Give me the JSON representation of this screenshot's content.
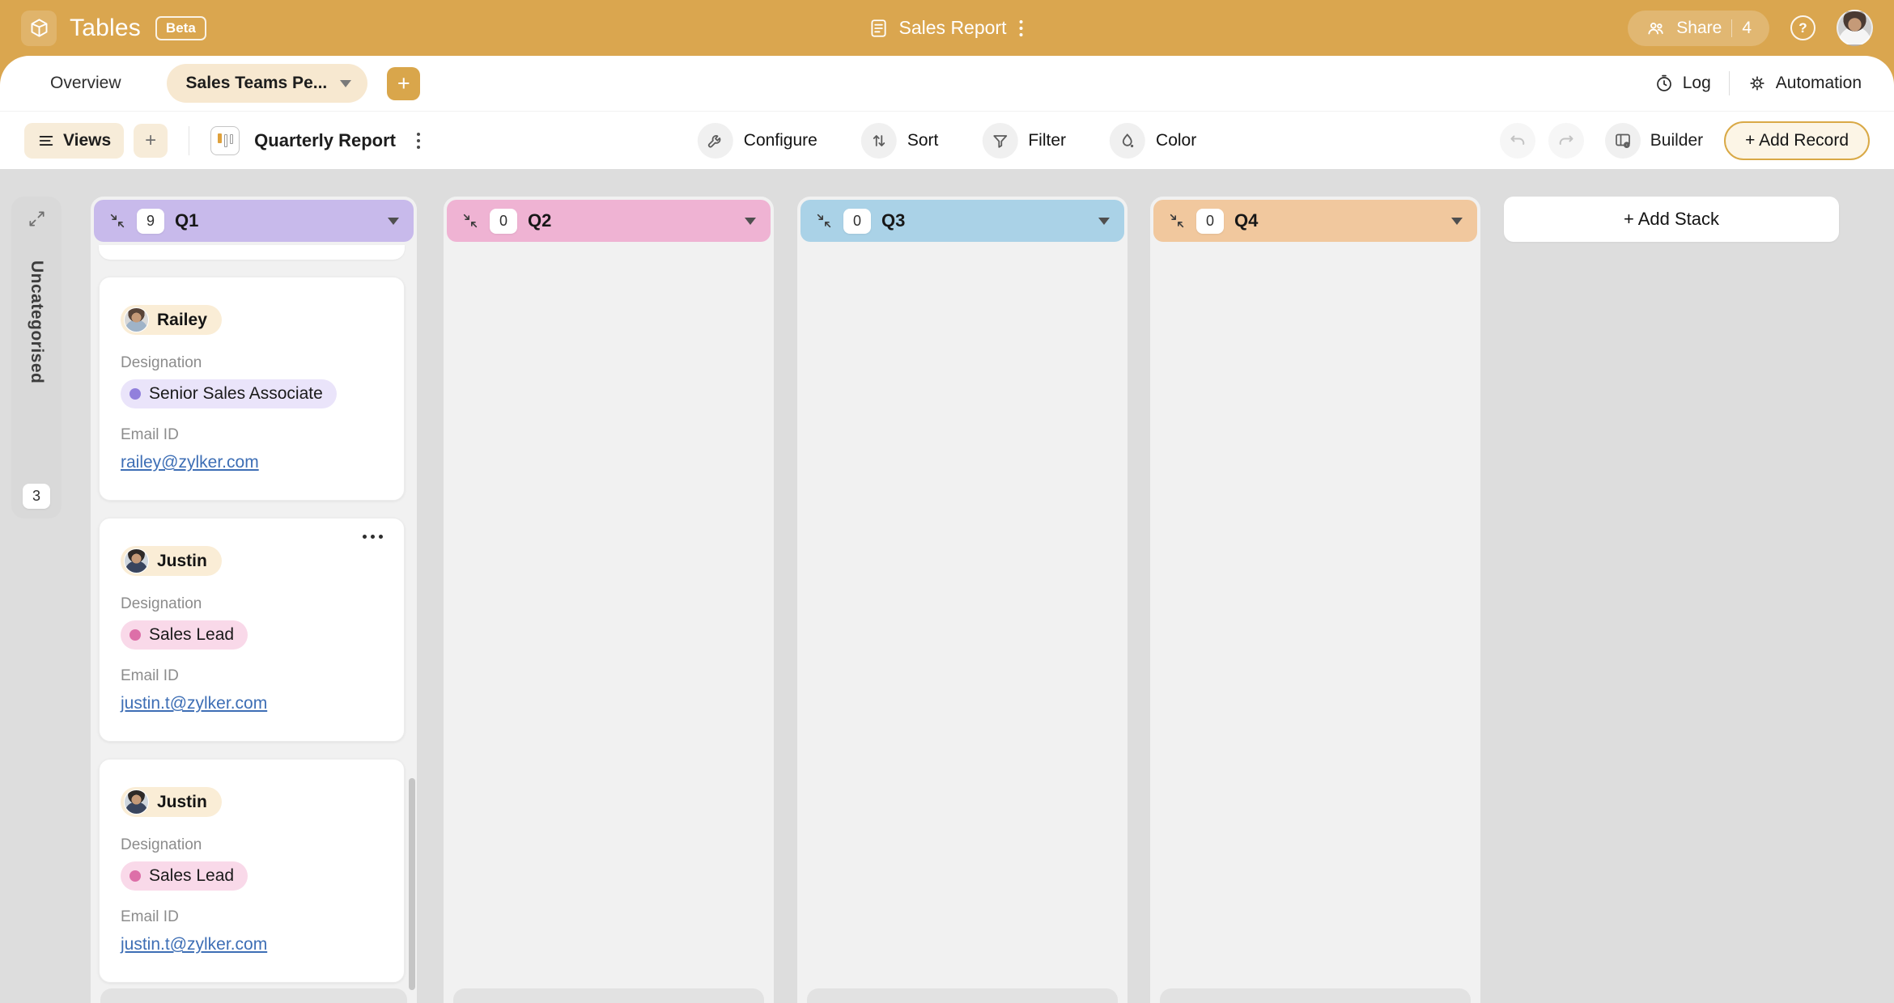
{
  "app": {
    "name": "Tables",
    "beta": "Beta",
    "doc_title": "Sales Report",
    "share_label": "Share",
    "share_count": "4",
    "help_glyph": "?",
    "header_color": "#DAA64F"
  },
  "tabbar": {
    "overview": "Overview",
    "view_selector": "Sales Teams Pe...",
    "add": "+",
    "log": "Log",
    "automation": "Automation"
  },
  "toolbar": {
    "views": "Views",
    "add": "+",
    "view_name": "Quarterly Report",
    "configure": "Configure",
    "sort": "Sort",
    "filter": "Filter",
    "color": "Color",
    "builder": "Builder",
    "add_record": "+ Add Record"
  },
  "board": {
    "uncategorised": {
      "label": "Uncategorised",
      "count": "3"
    },
    "add_stack": "+ Add Stack",
    "stacks": [
      {
        "label": "Q1",
        "count": "9",
        "color": "#C8BAEB"
      },
      {
        "label": "Q2",
        "count": "0",
        "color": "#EFB3D3"
      },
      {
        "label": "Q3",
        "count": "0",
        "color": "#AAD2E7"
      },
      {
        "label": "Q4",
        "count": "0",
        "color": "#F1C89E"
      }
    ],
    "field_labels": {
      "designation": "Designation",
      "email": "Email ID"
    },
    "cards": [
      {
        "name": "Railey",
        "designation": "Senior Sales Associate",
        "tag_bg": "#EAE4FA",
        "tag_dot": "#9180DC",
        "email": "railey@zylker.com"
      },
      {
        "name": "Justin",
        "designation": "Sales Lead",
        "tag_bg": "#F9D9E9",
        "tag_dot": "#DD6FA8",
        "email": "justin.t@zylker.com"
      },
      {
        "name": "Justin",
        "designation": "Sales Lead",
        "tag_bg": "#F9D9E9",
        "tag_dot": "#DD6FA8",
        "email": "justin.t@zylker.com"
      }
    ]
  }
}
